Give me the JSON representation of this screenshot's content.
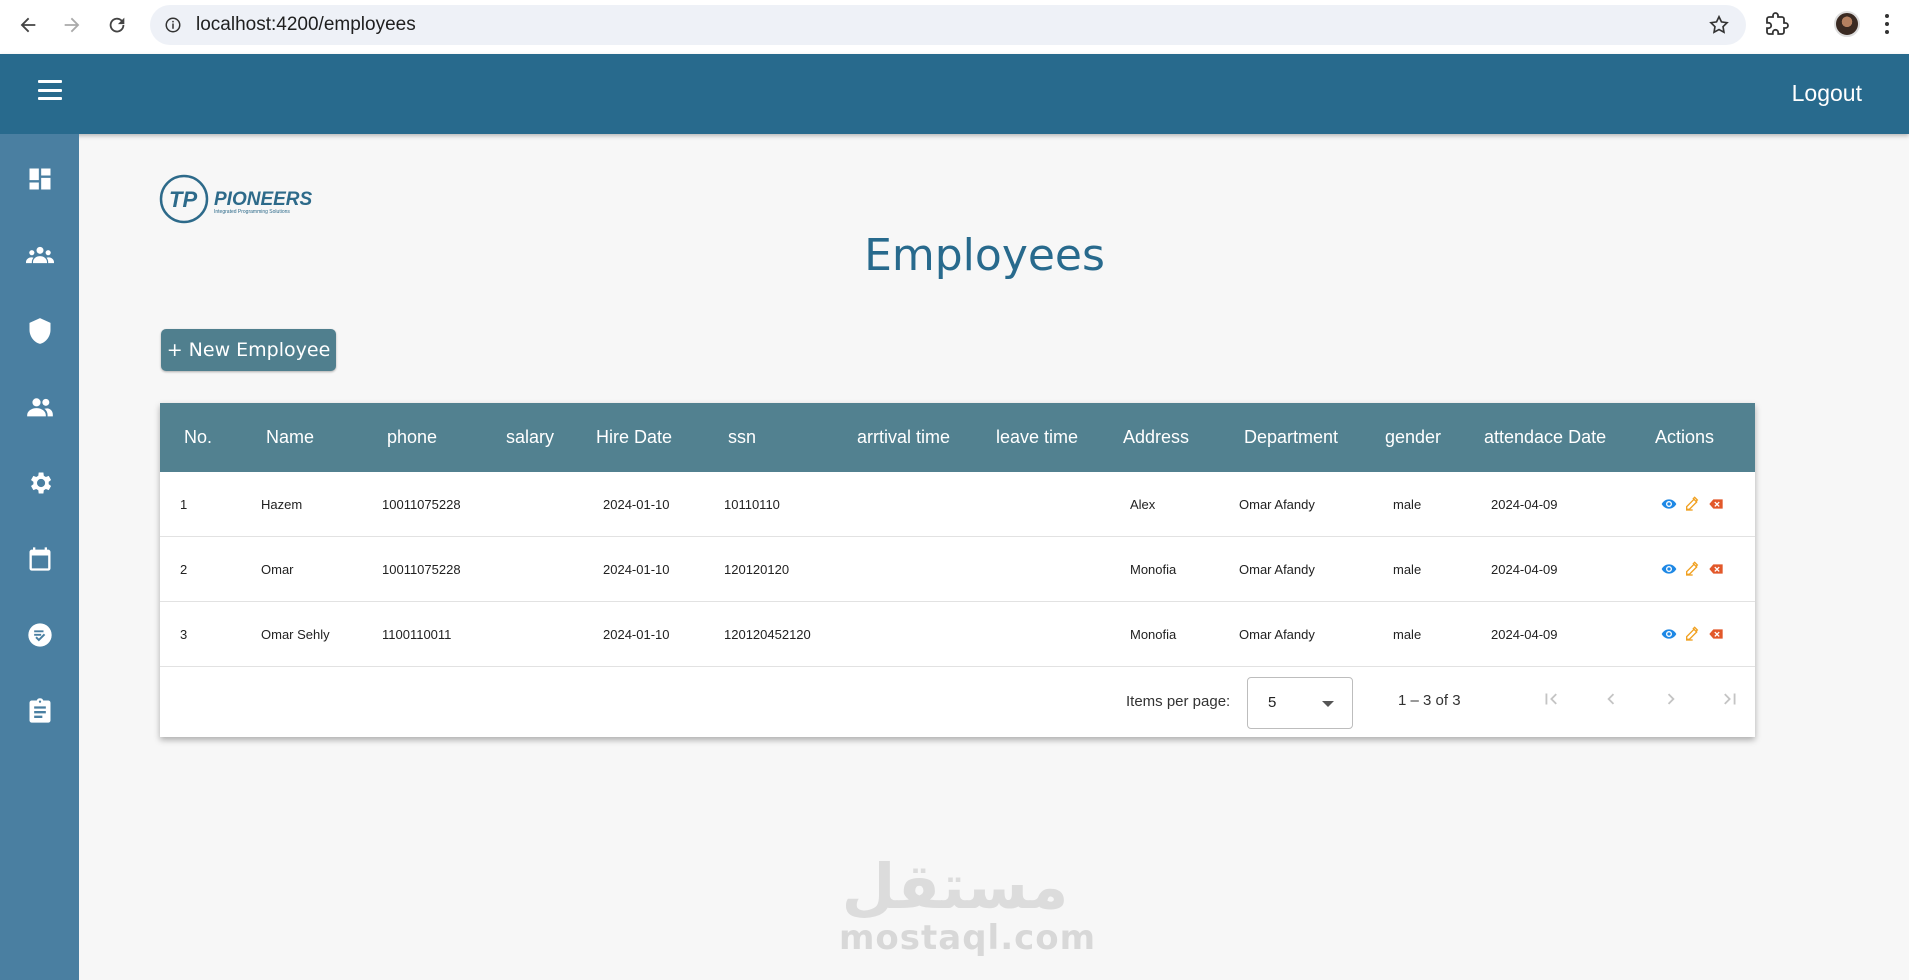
{
  "browser": {
    "url": "localhost:4200/employees"
  },
  "header": {
    "logout_label": "Logout"
  },
  "sidebar": {
    "items": [
      {
        "icon": "dashboard-icon"
      },
      {
        "icon": "group-icon"
      },
      {
        "icon": "shield-icon"
      },
      {
        "icon": "people-icon"
      },
      {
        "icon": "gear-icon"
      },
      {
        "icon": "calendar-icon"
      },
      {
        "icon": "task-check-icon"
      },
      {
        "icon": "clipboard-icon"
      }
    ]
  },
  "logo": {
    "brand": "PIONEERS",
    "tagline": "Integrated Programming Solutions"
  },
  "page": {
    "title": "Employees",
    "new_button_label": "+ New Employee"
  },
  "table": {
    "columns": [
      "No.",
      "Name",
      "phone",
      "salary",
      "Hire Date",
      "ssn",
      "arrtival time",
      "leave time",
      "Address",
      "Department",
      "gender",
      "attendace Date",
      "Actions"
    ],
    "rows": [
      {
        "no": "1",
        "name": "Hazem",
        "phone": "10011075228",
        "salary": "",
        "hire_date": "2024-01-10",
        "ssn": "10110110",
        "arrival": "",
        "leave": "",
        "address": "Alex",
        "department": "Omar Afandy",
        "gender": "male",
        "attendance_date": "2024-04-09"
      },
      {
        "no": "2",
        "name": "Omar",
        "phone": "10011075228",
        "salary": "",
        "hire_date": "2024-01-10",
        "ssn": "120120120",
        "arrival": "",
        "leave": "",
        "address": "Monofia",
        "department": "Omar Afandy",
        "gender": "male",
        "attendance_date": "2024-04-09"
      },
      {
        "no": "3",
        "name": "Omar Sehly",
        "phone": "1100110011",
        "salary": "",
        "hire_date": "2024-01-10",
        "ssn": "120120452120",
        "arrival": "",
        "leave": "",
        "address": "Monofia",
        "department": "Omar Afandy",
        "gender": "male",
        "attendance_date": "2024-04-09"
      }
    ]
  },
  "paginator": {
    "items_per_page_label": "Items per page:",
    "items_per_page_value": "5",
    "range_label": "1 – 3 of 3"
  },
  "colors": {
    "header": "#286a8d",
    "sidebar": "#4a7fa1",
    "table_header": "#528190",
    "view_icon": "#1e88e5",
    "edit_icon": "#f0a020",
    "delete_icon": "#e2582a"
  },
  "watermark": {
    "arabic": "مستقل",
    "latin": "mostaql.com"
  }
}
